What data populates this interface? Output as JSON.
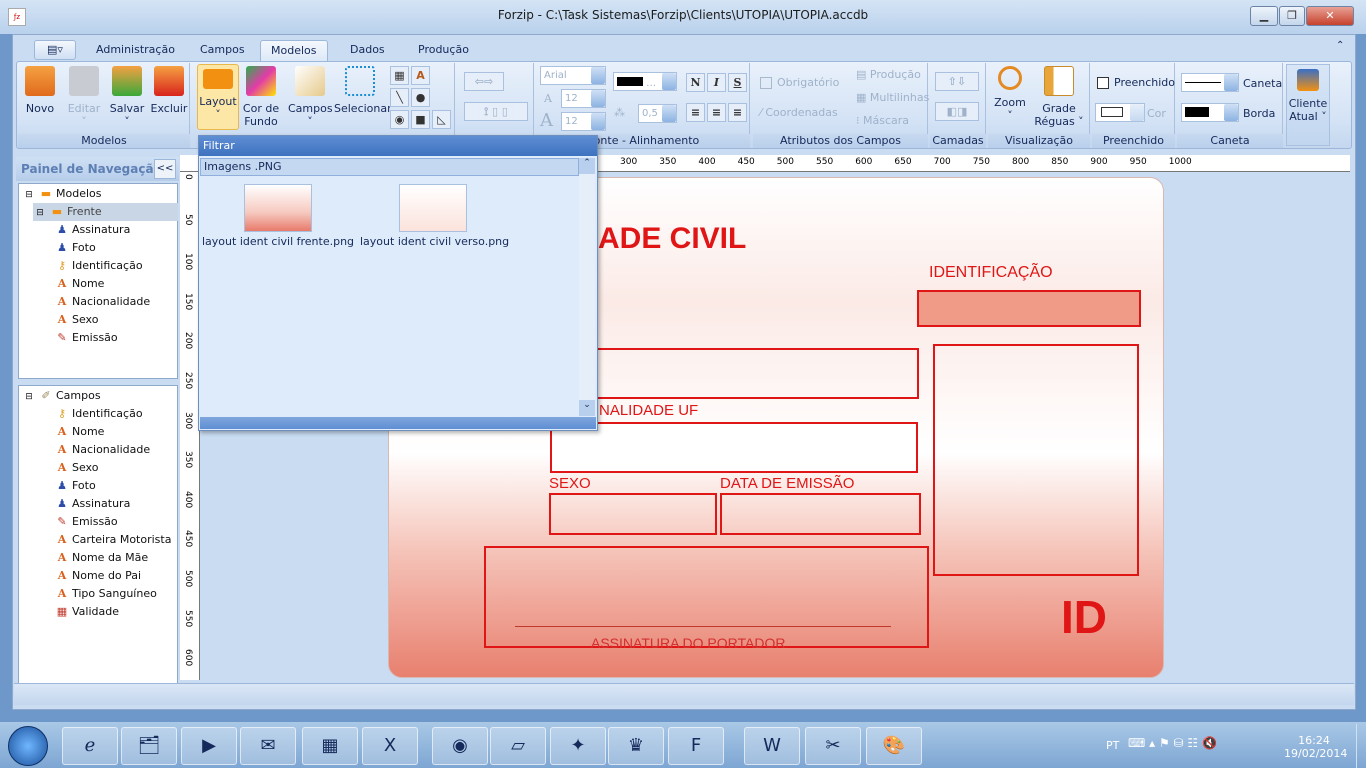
{
  "window": {
    "title": "Forzip - C:\\Task Sistemas\\Forzip\\Clients\\UTOPIA\\UTOPIA.accdb",
    "app_icon": "forzip-icon",
    "controls": [
      "minimize",
      "maximize",
      "close"
    ]
  },
  "tabs": [
    {
      "label": "Administração"
    },
    {
      "label": "Campos"
    },
    {
      "label": "Modelos",
      "active": true
    },
    {
      "label": "Dados"
    },
    {
      "label": "Produção"
    }
  ],
  "ribbon": {
    "modelos": {
      "label": "Modelos",
      "buttons": [
        {
          "label": "Novo"
        },
        {
          "label": "Editar",
          "disabled": true
        },
        {
          "label": "Salvar"
        },
        {
          "label": "Excluir"
        }
      ]
    },
    "layout": {
      "buttons": [
        {
          "label": "Layout"
        },
        {
          "label": "Cor de Fundo"
        },
        {
          "label": "Campos"
        },
        {
          "label": "Selecionar"
        }
      ]
    },
    "fonte": {
      "label": "Fonte - Alinhamento",
      "font": "Arial",
      "size1": "12",
      "size2": "12",
      "spacing": "0,5",
      "bold": "N",
      "italic": "I",
      "underline": "S"
    },
    "atributos": {
      "label": "Atributos dos Campos",
      "obrigatorio": "Obrigatório",
      "coordenadas": "Coordenadas",
      "producao": "Produção",
      "multilinhas": "Multilinhas",
      "mascara": "Máscara"
    },
    "camadas": {
      "label": "Camadas"
    },
    "visualizacao": {
      "label": "Visualização",
      "zoom": "Zoom",
      "grade": "Grade Réguas"
    },
    "preenchido": {
      "label": "Preenchido",
      "checkbox": "Preenchido",
      "cor": "Cor"
    },
    "caneta": {
      "label": "Caneta",
      "caneta": "Caneta",
      "borda": "Borda"
    },
    "cliente": {
      "label": "Cliente Atual"
    }
  },
  "nav": {
    "title": "Painel de Navegação",
    "collapse": "<<",
    "modelos": {
      "root": "Modelos",
      "child": "Frente",
      "items": [
        "Assinatura",
        "Foto",
        "Identificação",
        "Nome",
        "Nacionalidade",
        "Sexo",
        "Emissão"
      ]
    },
    "campos": {
      "root": "Campos",
      "items": [
        "Identificação",
        "Nome",
        "Nacionalidade",
        "Sexo",
        "Foto",
        "Assinatura",
        "Emissão",
        "Carteira Motorista",
        "Nome da Mãe",
        "Nome do Pai",
        "Tipo Sanguíneo",
        "Validade"
      ]
    }
  },
  "rulers": {
    "top": [
      "300",
      "350",
      "400",
      "450",
      "500",
      "550",
      "600",
      "650",
      "700",
      "750",
      "800",
      "850",
      "900",
      "950",
      "1000"
    ],
    "left": [
      "0",
      "50",
      "100",
      "150",
      "200",
      "250",
      "300",
      "350",
      "400",
      "450",
      "500",
      "550",
      "600"
    ]
  },
  "card": {
    "title": "ADE CIVIL",
    "identificacao": "IDENTIFICAÇÃO",
    "nacionalidade": "NALIDADE  UF",
    "sexo": "SEXO",
    "emissao": "DATA DE EMISSÃO",
    "assinatura": "ASSINATURA DO PORTADOR",
    "id": "ID",
    "accent": "#e01616"
  },
  "dropdown": {
    "header": "Filtrar",
    "section": "Imagens .PNG",
    "images": [
      "layout ident civil frente.png",
      "layout ident civil verso.png"
    ]
  },
  "taskbar": {
    "apps": [
      "internet-explorer",
      "file-explorer",
      "media-player",
      "mail",
      "calculator",
      "excel",
      "chrome",
      "notepad",
      "app-yellow",
      "app-red",
      "foxit",
      "word",
      "snipping-tool",
      "paint"
    ],
    "tray": {
      "lang": "PT",
      "time": "16:24",
      "date": "19/02/2014"
    }
  }
}
